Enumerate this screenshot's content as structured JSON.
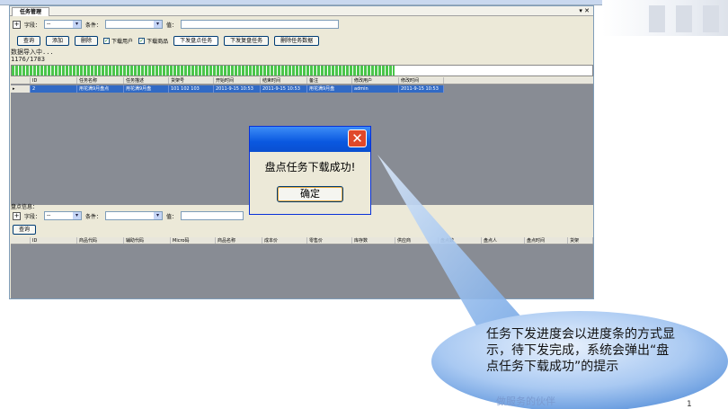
{
  "window": {
    "tab_title": "任务管理",
    "controls": "▾ ✕"
  },
  "filter": {
    "field_label": "字段：",
    "field_value": "--",
    "condition_label": "条件：",
    "value_label": "值：",
    "plus": "+"
  },
  "toolbar": {
    "query": "查询",
    "add": "添加",
    "delete": "删除",
    "download_users": "下载用户",
    "download_goods": "下载商品",
    "send_count_task": "下发盘点任务",
    "send_replenish_task": "下发复盘任务",
    "delete_task_data": "删除任务数据"
  },
  "status": {
    "line1": "数据导入中...",
    "line2": "1176/1783"
  },
  "progress": {
    "value": 1176,
    "total": 1783
  },
  "task_table": {
    "columns": [
      "ID",
      "任务名称",
      "任务描述",
      "货架号",
      "开始时间",
      "结束时间",
      "备注",
      "修改用户",
      "修改时间"
    ],
    "rows": [
      [
        "2",
        "用花满9月盘点",
        "用花满9月盘",
        "101 102 103",
        "2011-9-15 10:53",
        "2011-9-15 10:53",
        "用花满9月盘",
        "admin",
        "2011-9-15 10:53"
      ]
    ]
  },
  "lower": {
    "title": "盘点信息：",
    "query": "查询",
    "columns": [
      "ID",
      "商品代码",
      "辅助代码",
      "Micro码",
      "商品名称",
      "成本价",
      "零售价",
      "库存数",
      "供应商",
      "盘点数",
      "盘点人",
      "盘点时间",
      "货架"
    ]
  },
  "dialog": {
    "message": "盘点任务下载成功!",
    "ok": "确定",
    "close": "✕"
  },
  "callout": {
    "text": "任务下发进度会以进度条的方式显示，待下发完成，系统会弹出“盘点任务下载成功”的提示",
    "footer": "做服务的伙伴"
  },
  "pager": "1"
}
